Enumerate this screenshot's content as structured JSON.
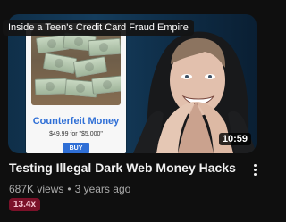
{
  "video": {
    "hover_title": "Inside a Teen's Credit Card Fraud Empire",
    "title": "Testing Illegal Dark Web Money Hacks",
    "views": "687K views",
    "separator": "•",
    "age": "3 years ago",
    "duration": "10:59",
    "badge": "13.4x"
  },
  "thumbnail": {
    "product_title": "Counterfeit Money",
    "product_price": "$49.99 for \"$5,000\"",
    "buy_label": "BUY"
  },
  "icons": {
    "more": "more-vert-icon"
  },
  "colors": {
    "background": "#0f0f0f",
    "product_accent": "#2f6fd6",
    "badge_bg": "#7b1129",
    "badge_text": "#f7c7d3"
  }
}
